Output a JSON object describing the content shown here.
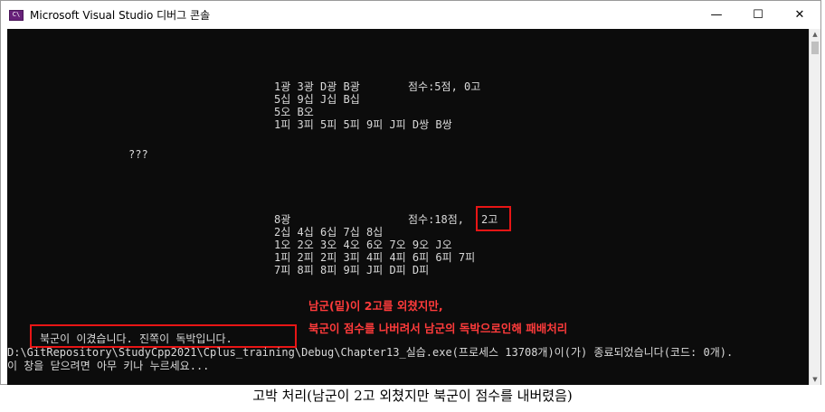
{
  "window": {
    "title": "Microsoft Visual Studio 디버그 콘솔",
    "app_icon_glyph": "C\\",
    "controls": {
      "minimize": "—",
      "maximize": "☐",
      "close": "✕"
    }
  },
  "console": {
    "top_player": {
      "lines": [
        "1광 3광 D광 B광",
        "5십 9십 J십 B십",
        "5오 B오",
        "1피 3피 5피 5피 9피 J피 D쌍 B쌍"
      ],
      "score": "점수:5점, 0고"
    },
    "middle": "???",
    "bottom_player": {
      "lines": [
        "8광",
        "2십 4십 6십 7십 8십",
        "1오 2오 3오 4오 6오 7오 9오 J오",
        "1피 2피 2피 3피 4피 4피 6피 6피 7피",
        "7피 8피 8피 9피 J피 D피 D피"
      ],
      "score_prefix": "점수:18점,",
      "score_go": "2고"
    },
    "annotation": {
      "line1": "남군(밑)이 2고를 외쳤지만,",
      "line2": "북군이 점수를 나버려서 남군의 독박으로인해 패배처리"
    },
    "result": "북군이 이겼습니다. 진쪽이 독박입니다.",
    "exit_line": "D:\\GitRepository\\StudyCpp2021\\Cplus_training\\Debug\\Chapter13_실습.exe(프로세스 13708개)이(가) 종료되었습니다(코드: 0개).",
    "close_prompt": "이 창을 닫으려면 아무 키나 누르세요..."
  },
  "caption": "고박 처리(남군이 2고 외쳤지만 북군이 점수를 내버렸음)",
  "colors": {
    "console_bg": "#0c0c0c",
    "console_text": "#d9d9d9",
    "highlight": "#e81515",
    "annotation_text": "#ff3b3b"
  }
}
